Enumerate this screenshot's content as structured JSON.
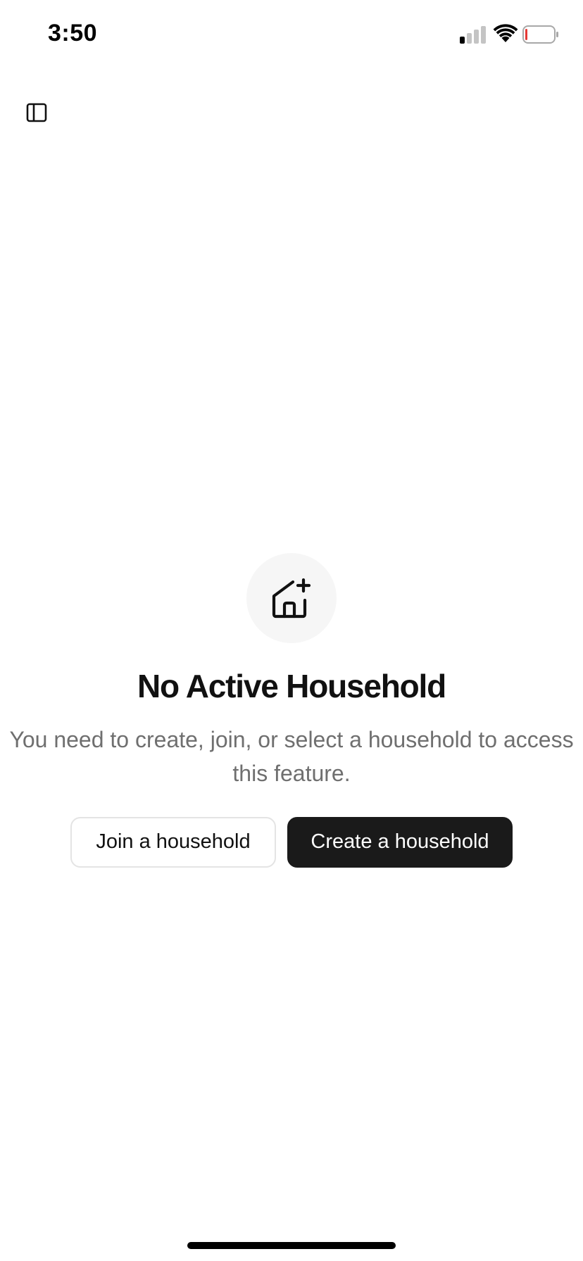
{
  "status_bar": {
    "time": "3:50",
    "signal_icon": "cellular-signal-icon",
    "wifi_icon": "wifi-icon",
    "battery_icon": "battery-low-icon",
    "battery_level_fraction": 0.05
  },
  "header": {
    "sidebar_toggle_icon": "sidebar-panel-icon"
  },
  "empty_state": {
    "icon": "house-plus-icon",
    "title": "No Active Household",
    "description": "You need to create, join, or select a household to access this feature."
  },
  "actions": {
    "join_label": "Join a household",
    "create_label": "Create a household"
  },
  "colors": {
    "primary_button_bg": "#1a1a1a",
    "description_text": "#6f6f6f",
    "battery_low": "#e53935"
  }
}
